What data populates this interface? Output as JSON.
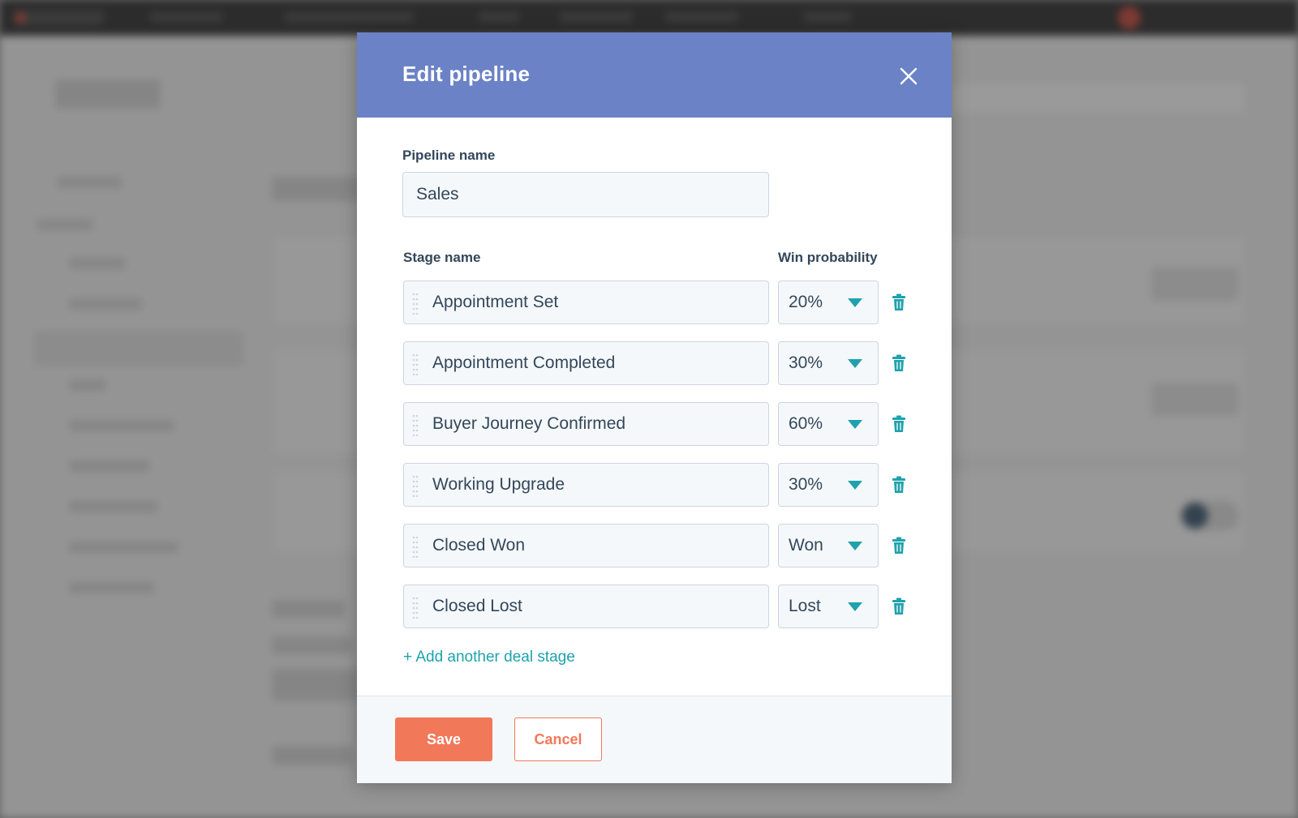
{
  "modal": {
    "title": "Edit pipeline",
    "close_icon": "close-icon",
    "pipeline_name_label": "Pipeline name",
    "pipeline_name_value": "Sales",
    "stage_name_header": "Stage name",
    "win_probability_header": "Win probability",
    "stages": [
      {
        "name": "Appointment Set",
        "probability": "20%"
      },
      {
        "name": "Appointment Completed",
        "probability": "30%"
      },
      {
        "name": "Buyer Journey Confirmed",
        "probability": "60%"
      },
      {
        "name": "Working Upgrade",
        "probability": "30%"
      },
      {
        "name": "Closed Won",
        "probability": "Won"
      },
      {
        "name": "Closed Lost",
        "probability": "Lost"
      }
    ],
    "add_stage_label": "+ Add another deal stage",
    "save_label": "Save",
    "cancel_label": "Cancel"
  },
  "colors": {
    "header_bg": "#6b82c6",
    "accent_teal": "#1fa2ac",
    "primary_orange": "#f2785a",
    "text_dark": "#33475b"
  }
}
